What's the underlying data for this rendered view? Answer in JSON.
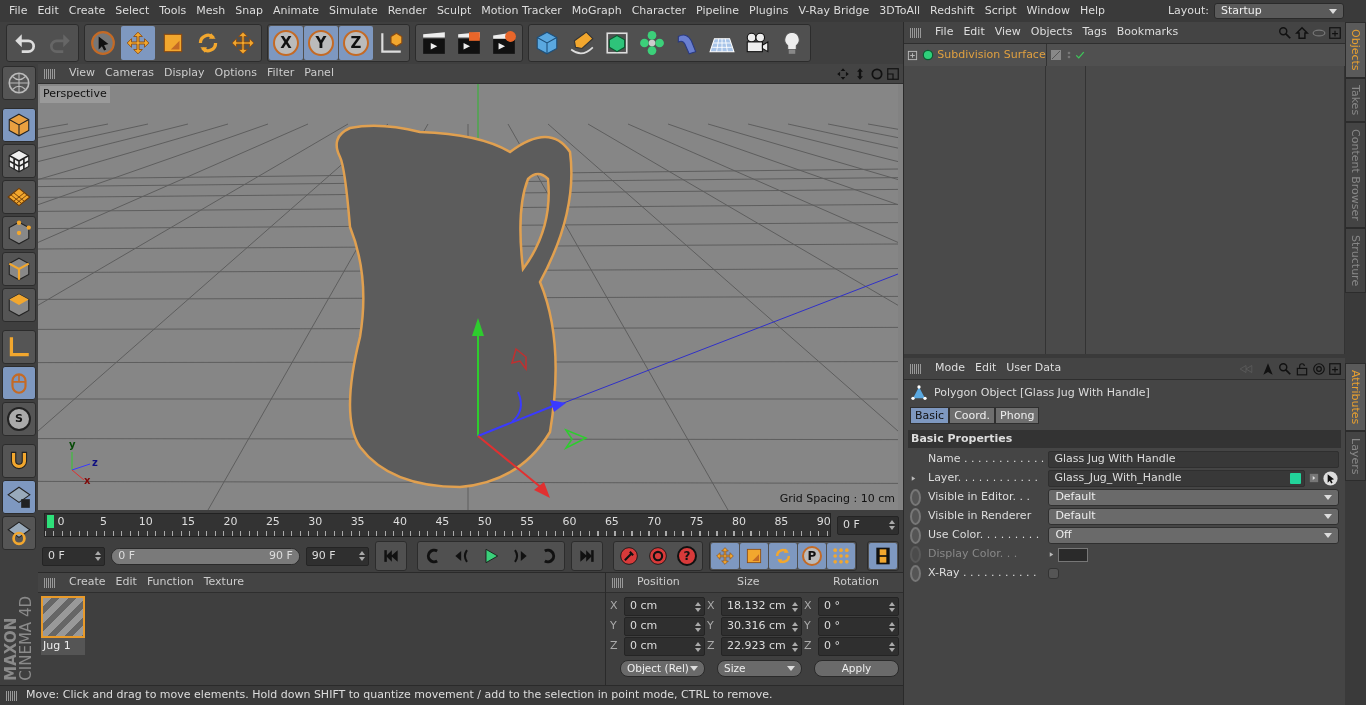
{
  "menu_bar": [
    "File",
    "Edit",
    "Create",
    "Select",
    "Tools",
    "Mesh",
    "Snap",
    "Animate",
    "Simulate",
    "Render",
    "Sculpt",
    "Motion Tracker",
    "MoGraph",
    "Character",
    "Pipeline",
    "Plugins",
    "V-Ray Bridge",
    "3DToAll",
    "Redshift",
    "Script",
    "Window",
    "Help"
  ],
  "layout": {
    "label": "Layout:",
    "value": "Startup"
  },
  "toolbar": [
    [
      {
        "kind": "undo",
        "selected": false
      },
      {
        "kind": "redo",
        "selected": false
      }
    ],
    [
      {
        "kind": "live-select",
        "selected": false
      },
      {
        "kind": "move",
        "selected": true
      },
      {
        "kind": "scale",
        "selected": false
      },
      {
        "kind": "rotate",
        "selected": false
      },
      {
        "kind": "recent",
        "selected": false
      }
    ],
    [
      {
        "kind": "axis",
        "label": "X",
        "selected": true
      },
      {
        "kind": "axis",
        "label": "Y",
        "selected": true
      },
      {
        "kind": "axis",
        "label": "Z",
        "selected": true
      },
      {
        "kind": "coords",
        "selected": false
      }
    ],
    [
      {
        "kind": "render-view",
        "selected": false
      },
      {
        "kind": "render-pv",
        "selected": false
      },
      {
        "kind": "render-settings",
        "selected": false
      }
    ],
    [
      {
        "kind": "cube",
        "selected": false
      },
      {
        "kind": "pen",
        "selected": false
      },
      {
        "kind": "subdiv",
        "selected": false
      },
      {
        "kind": "cloner",
        "selected": false
      },
      {
        "kind": "deformer",
        "selected": false
      },
      {
        "kind": "floor",
        "selected": false
      },
      {
        "kind": "camera",
        "selected": false
      },
      {
        "kind": "light",
        "selected": false
      }
    ]
  ],
  "left_toolbar": [
    {
      "kind": "globe",
      "selected": false
    },
    {
      "kind": "model",
      "selected": true
    },
    {
      "kind": "texture",
      "selected": false
    },
    {
      "kind": "workplane",
      "selected": false
    },
    {
      "kind": "points",
      "selected": false
    },
    {
      "kind": "edges",
      "selected": false
    },
    {
      "kind": "polygons",
      "selected": false
    },
    {
      "kind": "axis-l",
      "selected": false
    },
    {
      "kind": "tweak",
      "selected": true
    },
    {
      "kind": "snap",
      "label": "S",
      "selected": false
    },
    {
      "kind": "magnet",
      "selected": false
    },
    {
      "kind": "lock-grid",
      "selected": true
    },
    {
      "kind": "planar",
      "selected": false
    }
  ],
  "logo": {
    "brand": "MAXON",
    "product": "CINEMA 4D"
  },
  "viewport": {
    "menu": [
      "View",
      "Cameras",
      "Display",
      "Options",
      "Filter",
      "Panel"
    ],
    "camera": "Perspective",
    "axis_labels": [
      "y",
      "z",
      "x"
    ],
    "grid_spacing": "Grid Spacing : 10 cm"
  },
  "timeline": {
    "ticks": [
      "0",
      "5",
      "10",
      "15",
      "20",
      "25",
      "30",
      "35",
      "40",
      "45",
      "50",
      "55",
      "60",
      "65",
      "70",
      "75",
      "80",
      "85",
      "90"
    ],
    "level": 0,
    "current": "0 F"
  },
  "playback": {
    "start": "0 F",
    "range_start": "0 F",
    "range_end": "90 F",
    "range": {
      "level": 1
    },
    "end": "90 F",
    "buttons": [
      [
        {
          "kind": "go-start",
          "selected": false
        }
      ],
      [
        {
          "kind": "prev-key",
          "selected": false
        },
        {
          "kind": "prev-frame",
          "selected": false
        },
        {
          "kind": "play",
          "selected": false
        },
        {
          "kind": "next-frame",
          "selected": false
        },
        {
          "kind": "next-key",
          "selected": false
        }
      ],
      [
        {
          "kind": "go-end",
          "selected": false
        }
      ],
      [
        {
          "kind": "record",
          "selected": false
        },
        {
          "kind": "autokey",
          "selected": false
        },
        {
          "kind": "help",
          "label": "?",
          "selected": false
        }
      ],
      [
        {
          "kind": "move",
          "selected": true
        },
        {
          "kind": "scale",
          "selected": true
        },
        {
          "kind": "rotate",
          "selected": true
        },
        {
          "kind": "param",
          "label": "P",
          "selected": true
        },
        {
          "kind": "dots",
          "selected": true
        }
      ],
      [
        {
          "kind": "film",
          "selected": true
        }
      ]
    ]
  },
  "material_manager": {
    "menu": [
      "Create",
      "Edit",
      "Function",
      "Texture"
    ],
    "materials": [
      {
        "name": "Jug 1",
        "selected": true
      }
    ]
  },
  "coordinates": {
    "headers": [
      "Position",
      "Size",
      "Rotation"
    ],
    "rows": [
      {
        "axis": "X",
        "position": "0 cm",
        "size_axis": "X",
        "size": "18.132 cm",
        "rotation_axis": "X",
        "rotation": "0 °"
      },
      {
        "axis": "Y",
        "position": "0 cm",
        "size_axis": "Y",
        "size": "30.316 cm",
        "rotation_axis": "Y",
        "rotation": "0 °"
      },
      {
        "axis": "Z",
        "position": "0 cm",
        "size_axis": "Z",
        "size": "22.923 cm",
        "rotation_axis": "Z",
        "rotation": "0 °"
      }
    ],
    "mode": "Object (Rel)",
    "size_mode": "Size",
    "apply": "Apply"
  },
  "status_bar": "Move: Click and drag to move elements. Hold down SHIFT to quantize movement / add to the selection in point mode, CTRL to remove.",
  "objects_manager": {
    "menu": [
      "File",
      "Edit",
      "View",
      "Objects",
      "Tags",
      "Bookmarks"
    ],
    "objects": [
      {
        "name": "Subdivision Surface",
        "selected": true,
        "enabled": true
      }
    ]
  },
  "side_tabs_top": [
    {
      "label": "Objects",
      "selected": true
    },
    {
      "label": "Takes",
      "selected": false
    },
    {
      "label": "Content Browser",
      "selected": false
    },
    {
      "label": "Structure",
      "selected": false
    }
  ],
  "attributes": {
    "menu": [
      "Mode",
      "Edit",
      "User Data"
    ],
    "title": "Polygon Object [Glass Jug With Handle]",
    "tabs": [
      {
        "label": "Basic",
        "selected": true
      },
      {
        "label": "Coord.",
        "selected": false
      },
      {
        "label": "Phong",
        "selected": false
      }
    ],
    "section": "Basic Properties",
    "fields": [
      {
        "kind": "text",
        "label": "Name . . . . . . . . . . . .",
        "value": "Glass Jug With Handle",
        "disabled": false
      },
      {
        "kind": "layer",
        "label": "Layer. . . . . . . . . . . .",
        "value": "Glass_Jug_With_Handle",
        "color": "#22d39a",
        "disabled": false
      },
      {
        "kind": "dropdown",
        "label": "Visible in Editor. . .",
        "value": "Default",
        "disabled": false
      },
      {
        "kind": "dropdown",
        "label": "Visible in Renderer",
        "value": "Default",
        "disabled": false
      },
      {
        "kind": "dropdown",
        "label": "Use Color. . . . . . . . .",
        "value": "Off",
        "disabled": false
      },
      {
        "kind": "color",
        "label": "Display Color. . .",
        "disabled": true
      },
      {
        "kind": "checkbox",
        "label": "X-Ray . . . . . . . . . . .",
        "checked": false,
        "disabled": false
      }
    ]
  },
  "side_tabs_bottom": [
    {
      "label": "Attributes",
      "selected": true
    },
    {
      "label": "Layers",
      "selected": false
    }
  ]
}
